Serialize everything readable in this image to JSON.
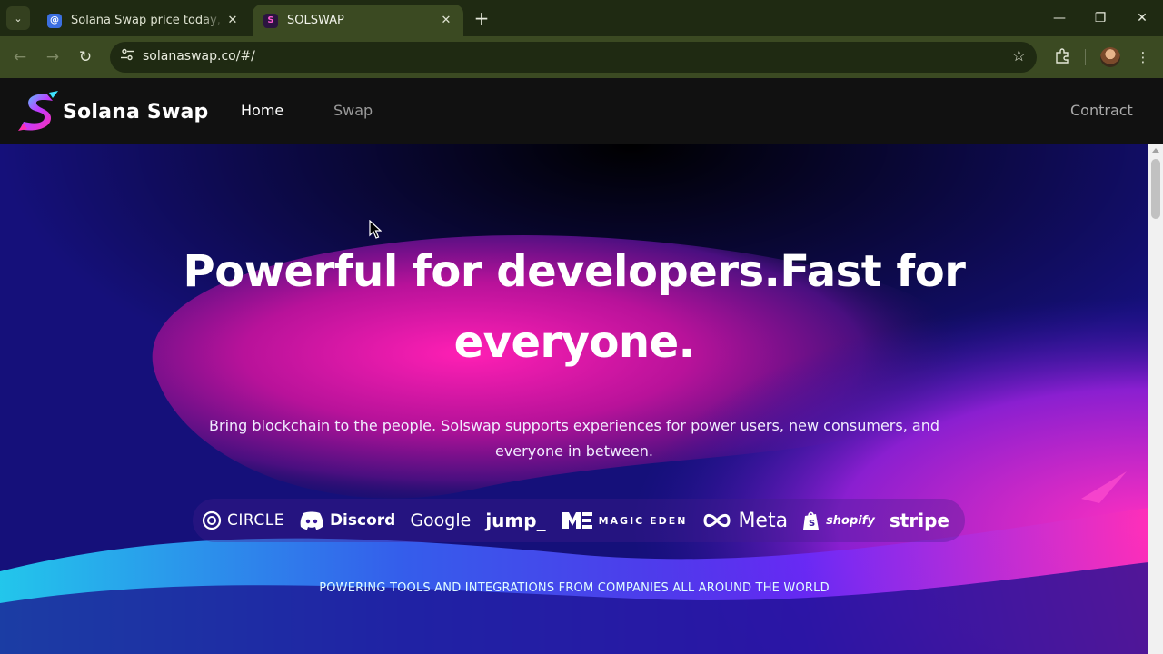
{
  "browser": {
    "tabs": [
      {
        "title": "Solana Swap price today, SOS to",
        "favicon": "coin-icon",
        "active": false
      },
      {
        "title": "SOLSWAP",
        "favicon": "solswap-icon",
        "active": true
      }
    ],
    "url": "solanaswap.co/#/",
    "new_tab_symbol": "+",
    "close_symbol": "✕"
  },
  "site": {
    "brand_name": "Solana Swap",
    "nav": {
      "home": "Home",
      "swap": "Swap",
      "contract": "Contract"
    }
  },
  "hero": {
    "headline_line1": "Powerful for developers.Fast for",
    "headline_line2": "everyone.",
    "subtext": "Bring blockchain to the people. Solswap supports experiences for power users, new consumers, and everyone in between.",
    "partners": [
      "CIRCLE",
      "Discord",
      "Google",
      "jump_",
      "MAGIC EDEN",
      "Meta",
      "shopify",
      "stripe"
    ],
    "powering": "POWERING TOOLS AND INTEGRATIONS FROM COMPANIES ALL AROUND THE WORLD"
  },
  "colors": {
    "browser_frame": "#1f2a12",
    "browser_toolbar": "#3b4a22",
    "site_nav": "#111111",
    "accent_pink": "#ff1fb4",
    "accent_cyan": "#25e6ff",
    "hero_deep": "#120a4a"
  }
}
